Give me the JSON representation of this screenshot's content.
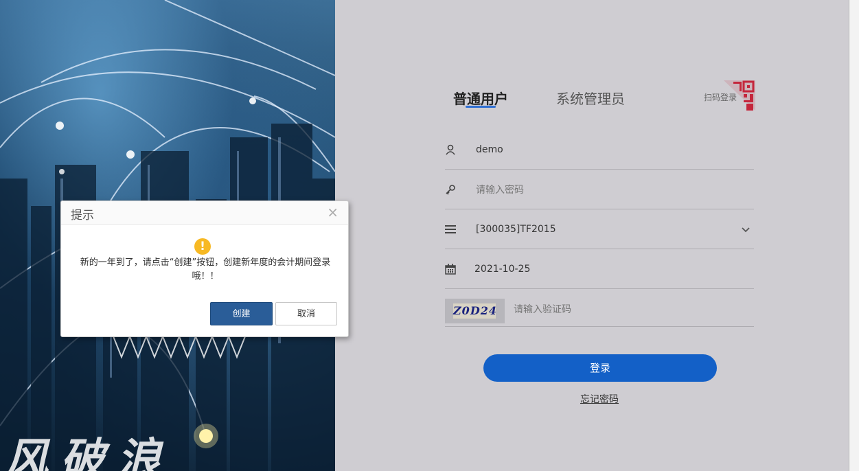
{
  "hero": {
    "slogan": "风破浪"
  },
  "tabs": [
    {
      "label": "普通用户",
      "active": true
    },
    {
      "label": "系统管理员",
      "active": false
    }
  ],
  "qr": {
    "label": "扫码登录",
    "icon": "qr-code-icon"
  },
  "form": {
    "username": {
      "value": "demo",
      "icon": "user-icon"
    },
    "password": {
      "placeholder": "请输入密码",
      "icon": "key-icon"
    },
    "account_set": {
      "value": "[300035]TF2015",
      "icon": "list-icon"
    },
    "date": {
      "value": "2021-10-25",
      "icon": "calendar-icon"
    },
    "captcha": {
      "code": "Z0D24",
      "placeholder": "请输入验证码"
    },
    "login_label": "登录",
    "forgot_label": "忘记密码"
  },
  "modal": {
    "title": "提示",
    "close": "×",
    "icon": "!",
    "message": "新的一年到了，请点击“创建”按钮，创建新年度的会计期间登录哦！！",
    "confirm_label": "创建",
    "cancel_label": "取消"
  },
  "colors": {
    "primary": "#1360c7",
    "modal_primary": "#2a5d98",
    "warning": "#f7b924",
    "tab_underline": "#2f6fd3",
    "qr_accent": "#c4263c"
  }
}
